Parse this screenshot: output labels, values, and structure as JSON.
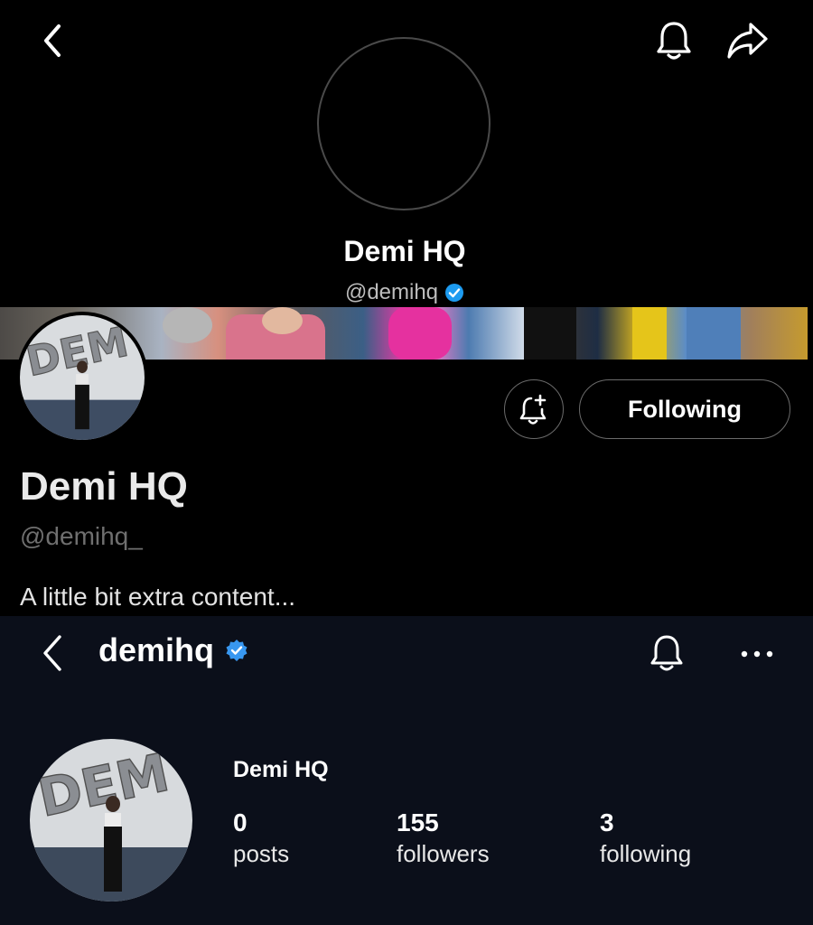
{
  "top": {
    "display_name": "Demi HQ",
    "handle": "@demihq",
    "profile_name": "Demi HQ",
    "profile_handle": "@demihq_",
    "bio": "A little bit extra content...",
    "following_label": "Following",
    "icons": {
      "back": "chevron-left-icon",
      "bell": "bell-icon",
      "share": "share-arrow-icon",
      "notify_add": "bell-plus-icon",
      "verified": "verified-badge-icon"
    },
    "verified_color": "#1d9bf0"
  },
  "instagram": {
    "username": "demihq",
    "display_name": "Demi HQ",
    "stats": {
      "posts_count": "0",
      "posts_label": "posts",
      "followers_count": "155",
      "followers_label": "followers",
      "following_count": "3",
      "following_label": "following"
    },
    "icons": {
      "back": "chevron-left-icon",
      "bell": "bell-icon",
      "more": "more-dots-icon",
      "verified": "verified-badge-icon"
    },
    "verified_color": "#3897f0",
    "background_color": "#0b0f1a"
  }
}
